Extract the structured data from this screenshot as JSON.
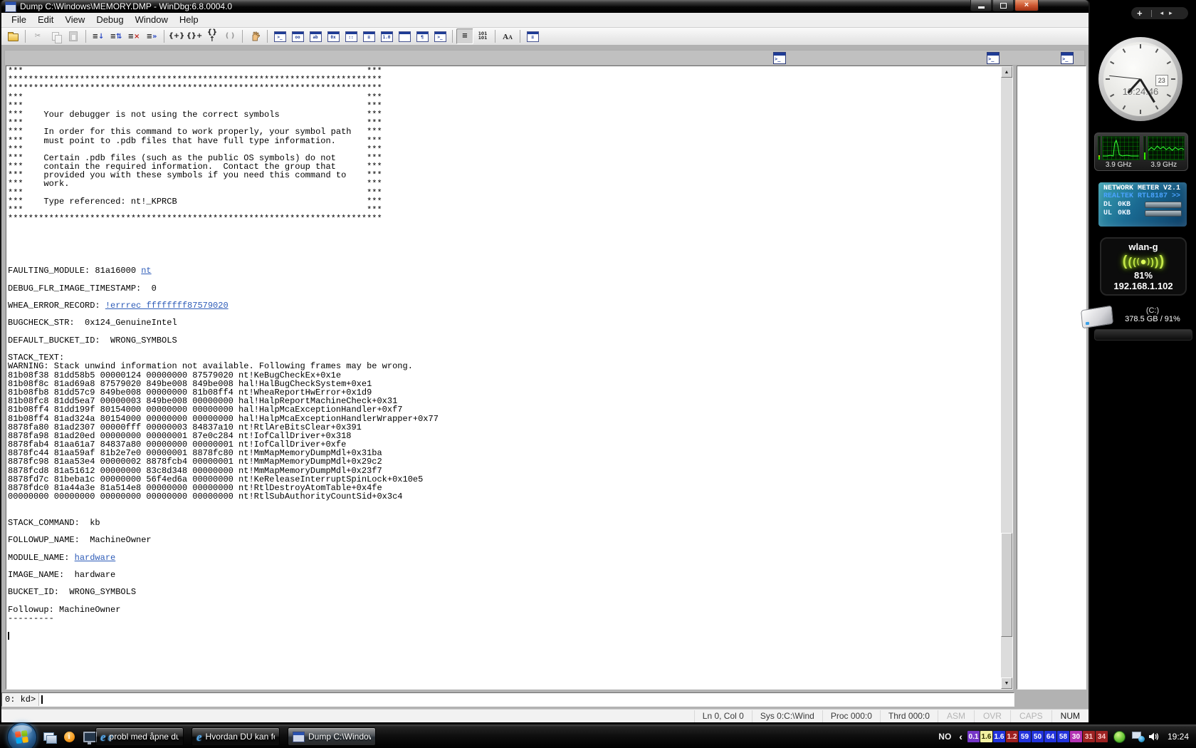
{
  "window": {
    "title": "Dump C:\\Windows\\MEMORY.DMP - WinDbg:6.8.0004.0",
    "menu_items": [
      "File",
      "Edit",
      "View",
      "Debug",
      "Window",
      "Help"
    ],
    "toolbar": [
      {
        "n": "open-source-file",
        "k": "folder"
      },
      {
        "n": "cut",
        "k": "cut",
        "d": 1,
        "s": 1
      },
      {
        "n": "copy",
        "k": "copy",
        "d": 1
      },
      {
        "n": "paste",
        "k": "paste",
        "d": 1
      },
      {
        "n": "go",
        "k": "t",
        "g": "≡",
        "g2": "↓",
        "c2": "#2747c4",
        "s": 1
      },
      {
        "n": "restart",
        "k": "t",
        "g": "≡",
        "g2": "⇅",
        "c2": "#2747c4"
      },
      {
        "n": "stop-debugging",
        "k": "t",
        "g": "≡",
        "g2": "×",
        "c2": "#c0271f"
      },
      {
        "n": "detach-process",
        "k": "t",
        "g": "≡",
        "g2": "»",
        "c2": "#2747c4"
      },
      {
        "n": "step-into",
        "k": "t",
        "g": "{+}",
        "s": 1
      },
      {
        "n": "step-over",
        "k": "t",
        "g": "{}+"
      },
      {
        "n": "step-out",
        "k": "t",
        "g": "{}↑"
      },
      {
        "n": "run-to-cursor",
        "k": "t",
        "g": "( )",
        "d": 1
      },
      {
        "n": "break",
        "k": "hand",
        "s": 1
      },
      {
        "n": "command-window",
        "k": "win",
        "g": ">_",
        "s": 1
      },
      {
        "n": "watch-window",
        "k": "win",
        "g": "oo"
      },
      {
        "n": "locals-window",
        "k": "win",
        "g": "ab"
      },
      {
        "n": "registers-window",
        "k": "win",
        "g": "0x"
      },
      {
        "n": "memory-window",
        "k": "win",
        "g": "::"
      },
      {
        "n": "call-stack-window",
        "k": "win",
        "g": "≡"
      },
      {
        "n": "disassembly-window",
        "k": "win",
        "g": "1.0"
      },
      {
        "n": "scratch-pad-window",
        "k": "win",
        "g": ""
      },
      {
        "n": "processes-threads-window",
        "k": "win",
        "g": "¶"
      },
      {
        "n": "command-browser-window",
        "k": "win",
        "g": ">_"
      },
      {
        "n": "source-mode-toggle",
        "k": "t",
        "g": "≡",
        "pressed": 1,
        "s": 1
      },
      {
        "n": "assembly-options",
        "k": "t",
        "g": "101\n101"
      },
      {
        "n": "font",
        "k": "font",
        "s": 1
      },
      {
        "n": "toolbar-options",
        "k": "win",
        "g": "≡",
        "s": 1
      }
    ],
    "prompt_label": "0: kd>",
    "statusbar": {
      "info": [
        "Ln 0, Col 0",
        "Sys 0:C:\\Wind",
        "Proc 000:0",
        "Thrd 000:0"
      ],
      "toggles": [
        {
          "label": "ASM",
          "enabled": false
        },
        {
          "label": "OVR",
          "enabled": false
        },
        {
          "label": "CAPS",
          "enabled": false
        },
        {
          "label": "NUM",
          "enabled": true
        }
      ]
    }
  },
  "console": {
    "lines": [
      {
        "type": "box",
        "text": ""
      },
      {
        "type": "stars"
      },
      {
        "type": "stars"
      },
      {
        "type": "box",
        "text": ""
      },
      {
        "type": "box",
        "text": ""
      },
      {
        "type": "box",
        "text": "Your debugger is not using the correct symbols"
      },
      {
        "type": "box",
        "text": ""
      },
      {
        "type": "box",
        "text": "In order for this command to work properly, your symbol path"
      },
      {
        "type": "box",
        "text": "must point to .pdb files that have full type information."
      },
      {
        "type": "box",
        "text": ""
      },
      {
        "type": "box",
        "text": "Certain .pdb files (such as the public OS symbols) do not"
      },
      {
        "type": "box",
        "text": "contain the required information.  Contact the group that"
      },
      {
        "type": "box",
        "text": "provided you with these symbols if you need this command to"
      },
      {
        "type": "box",
        "text": "work."
      },
      {
        "type": "box",
        "text": ""
      },
      {
        "type": "box",
        "text": "Type referenced: nt!_KPRCB"
      },
      {
        "type": "box",
        "text": ""
      },
      {
        "type": "stars"
      },
      {
        "type": "blank"
      },
      {
        "type": "blank"
      },
      {
        "type": "blank"
      },
      {
        "type": "blank"
      },
      {
        "type": "blank"
      },
      {
        "type": "parts",
        "parts": [
          {
            "text": "FAULTING_MODULE: 81a16000 "
          },
          {
            "text": "nt",
            "link": true
          }
        ]
      },
      {
        "type": "blank"
      },
      {
        "type": "plain",
        "text": "DEBUG_FLR_IMAGE_TIMESTAMP:  0"
      },
      {
        "type": "blank"
      },
      {
        "type": "parts",
        "parts": [
          {
            "text": "WHEA_ERROR_RECORD: "
          },
          {
            "text": "!errrec ffffffff87579020",
            "link": true
          }
        ]
      },
      {
        "type": "blank"
      },
      {
        "type": "plain",
        "text": "BUGCHECK_STR:  0x124_GenuineIntel"
      },
      {
        "type": "blank"
      },
      {
        "type": "plain",
        "text": "DEFAULT_BUCKET_ID:  WRONG_SYMBOLS"
      },
      {
        "type": "blank"
      },
      {
        "type": "plain",
        "text": "STACK_TEXT:"
      },
      {
        "type": "plain",
        "text": "WARNING: Stack unwind information not available. Following frames may be wrong."
      },
      {
        "type": "plain",
        "text": "81b08f38 81dd58b5 00000124 00000000 87579020 nt!KeBugCheckEx+0x1e"
      },
      {
        "type": "plain",
        "text": "81b08f8c 81ad69a8 87579020 849be008 849be008 hal!HalBugCheckSystem+0xe1"
      },
      {
        "type": "plain",
        "text": "81b08fb8 81dd57c9 849be008 00000000 81b08ff4 nt!WheaReportHwError+0x1d9"
      },
      {
        "type": "plain",
        "text": "81b08fc8 81dd5ea7 00000003 849be008 00000000 hal!HalpReportMachineCheck+0x31"
      },
      {
        "type": "plain",
        "text": "81b08ff4 81dd199f 80154000 00000000 00000000 hal!HalpMcaExceptionHandler+0xf7"
      },
      {
        "type": "plain",
        "text": "81b08ff4 81ad324a 80154000 00000000 00000000 hal!HalpMcaExceptionHandlerWrapper+0x77"
      },
      {
        "type": "plain",
        "text": "8878fa80 81ad2307 00000fff 00000003 84837a10 nt!RtlAreBitsClear+0x391"
      },
      {
        "type": "plain",
        "text": "8878fa98 81ad20ed 00000000 00000001 87e0c284 nt!IofCallDriver+0x318"
      },
      {
        "type": "plain",
        "text": "8878fab4 81aa61a7 84837a80 00000000 00000001 nt!IofCallDriver+0xfe"
      },
      {
        "type": "plain",
        "text": "8878fc44 81aa59af 81b2e7e0 00000001 8878fc80 nt!MmMapMemoryDumpMdl+0x31ba"
      },
      {
        "type": "plain",
        "text": "8878fc98 81aa53e4 00000002 8878fcb4 00000001 nt!MmMapMemoryDumpMdl+0x29c2"
      },
      {
        "type": "plain",
        "text": "8878fcd8 81a51612 00000000 83c8d348 00000000 nt!MmMapMemoryDumpMdl+0x23f7"
      },
      {
        "type": "plain",
        "text": "8878fd7c 81beba1c 00000000 56f4ed6a 00000000 nt!KeReleaseInterruptSpinLock+0x10e5"
      },
      {
        "type": "plain",
        "text": "8878fdc0 81a44a3e 81a514e8 00000000 00000000 nt!RtlDestroyAtomTable+0x4fe"
      },
      {
        "type": "plain",
        "text": "00000000 00000000 00000000 00000000 00000000 nt!RtlSubAuthorityCountSid+0x3c4"
      },
      {
        "type": "blank"
      },
      {
        "type": "blank"
      },
      {
        "type": "plain",
        "text": "STACK_COMMAND:  kb"
      },
      {
        "type": "blank"
      },
      {
        "type": "plain",
        "text": "FOLLOWUP_NAME:  MachineOwner"
      },
      {
        "type": "blank"
      },
      {
        "type": "parts",
        "parts": [
          {
            "text": "MODULE_NAME: "
          },
          {
            "text": "hardware",
            "link": true
          }
        ]
      },
      {
        "type": "blank"
      },
      {
        "type": "plain",
        "text": "IMAGE_NAME:  hardware"
      },
      {
        "type": "blank"
      },
      {
        "type": "plain",
        "text": "BUCKET_ID:  WRONG_SYMBOLS"
      },
      {
        "type": "blank"
      },
      {
        "type": "plain",
        "text": "Followup: MachineOwner"
      },
      {
        "type": "plain",
        "text": "---------"
      },
      {
        "type": "blank"
      },
      {
        "type": "caret"
      }
    ]
  },
  "sidebar": {
    "controls": {
      "add_glyph": "+",
      "prev_glyph": "◂",
      "next_glyph": "▸"
    },
    "clock": {
      "time": "19:24:46",
      "date_day": "23"
    },
    "cpu": {
      "meters": [
        {
          "label": "3.9 GHz"
        },
        {
          "label": "3.9 GHz"
        }
      ]
    },
    "network_meter": {
      "title": "NETWORK METER V2.1",
      "adapter": "REALTEK RTL8187 >>",
      "dl_label": "DL",
      "dl_value": "0KB",
      "ul_label": "UL",
      "ul_value": "0KB"
    },
    "wlan": {
      "name": "wlan-g",
      "arcs_left": "((((",
      "dot": "●",
      "arcs_right": "))))",
      "signal_percent": "81%",
      "ip": "192.168.1.102"
    },
    "disk": {
      "name": "(C:)",
      "usage": "378.5 GB / 91%"
    }
  },
  "taskbar": {
    "quick_launch": [
      {
        "kind": "show-desktop"
      },
      {
        "kind": "info"
      },
      {
        "kind": "remote-desktop"
      },
      {
        "kind": "internet-explorer"
      }
    ],
    "tasks": [
      {
        "icon": "internet-explorer",
        "label": "probl med åpne du...",
        "active": false
      },
      {
        "icon": "internet-explorer",
        "label": "Hvordan DU kan feil...",
        "active": false
      },
      {
        "icon": "windbg",
        "label": "Dump C:\\Windows\\...",
        "active": true
      }
    ],
    "tray": {
      "language": "NO",
      "meters": [
        {
          "v": "0.1",
          "bg": "#7636c8",
          "fg": "#ffffff"
        },
        {
          "v": "1.6",
          "bg": "#f3f0a0",
          "fg": "#333300"
        },
        {
          "v": "1.6",
          "bg": "#2233dd",
          "fg": "#ffffff"
        },
        {
          "v": "1.2",
          "bg": "#9c1f1f",
          "fg": "#ffdddd"
        },
        {
          "v": "59",
          "bg": "#2233dd",
          "fg": "#ffffff"
        },
        {
          "v": "50",
          "bg": "#2233dd",
          "fg": "#ffffff"
        },
        {
          "v": "64",
          "bg": "#2233dd",
          "fg": "#ffffff"
        },
        {
          "v": "58",
          "bg": "#2233dd",
          "fg": "#ffffff"
        },
        {
          "v": "30",
          "bg": "#b433b4",
          "fg": "#ffffff"
        },
        {
          "v": "31",
          "bg": "#9c2222",
          "fg": "#ffcccc"
        },
        {
          "v": "34",
          "bg": "#9c2222",
          "fg": "#ffcccc"
        }
      ],
      "time": "19:24"
    }
  }
}
